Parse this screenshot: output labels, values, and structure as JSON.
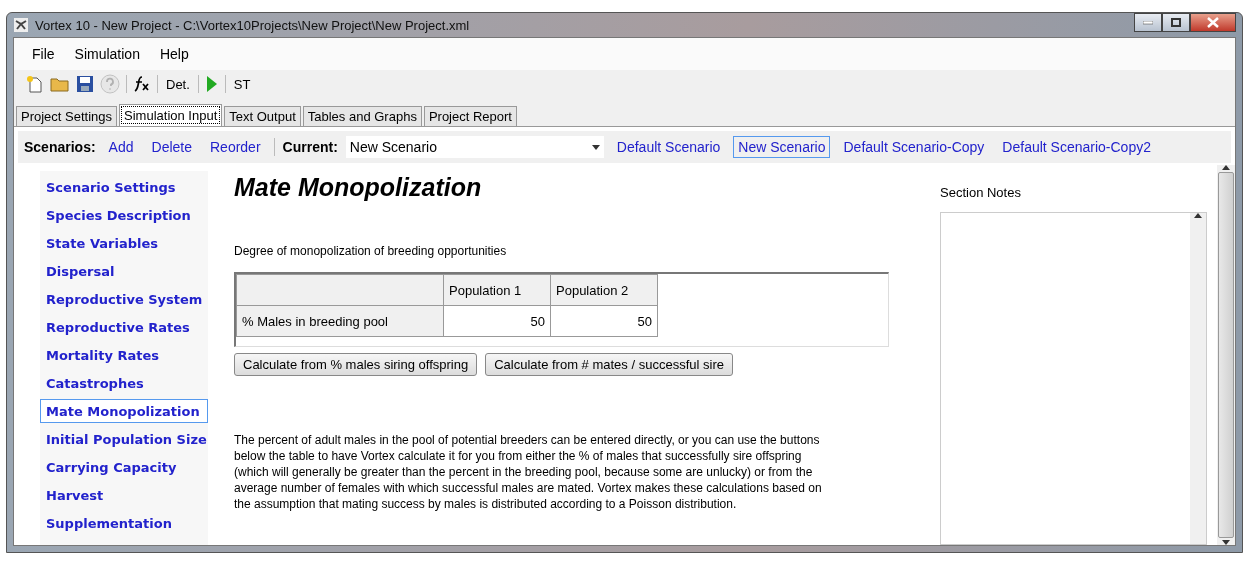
{
  "window": {
    "title": "Vortex 10 - New Project - C:\\Vortex10Projects\\New Project\\New Project.xml"
  },
  "menu": [
    "File",
    "Simulation",
    "Help"
  ],
  "toolbar": [
    {
      "kind": "new"
    },
    {
      "kind": "open"
    },
    {
      "kind": "save"
    },
    {
      "kind": "help",
      "disabled": true
    },
    {
      "kind": "sep"
    },
    {
      "kind": "fx"
    },
    {
      "kind": "sep"
    },
    {
      "kind": "text",
      "label": "Det."
    },
    {
      "kind": "sep"
    },
    {
      "kind": "run"
    },
    {
      "kind": "sep"
    },
    {
      "kind": "text",
      "label": "ST"
    }
  ],
  "tabs": [
    {
      "label": "Project Settings",
      "selected": false
    },
    {
      "label": "Simulation Input",
      "selected": true
    },
    {
      "label": "Text Output",
      "selected": false
    },
    {
      "label": "Tables and Graphs",
      "selected": false
    },
    {
      "label": "Project Report",
      "selected": false
    }
  ],
  "scenario_bar": {
    "label": "Scenarios:",
    "actions": [
      "Add",
      "Delete",
      "Reorder"
    ],
    "current_label": "Current:",
    "current_value": "New Scenario",
    "scenarios": [
      {
        "label": "Default Scenario",
        "selected": false
      },
      {
        "label": "New Scenario",
        "selected": true
      },
      {
        "label": "Default Scenario-Copy",
        "selected": false
      },
      {
        "label": "Default Scenario-Copy2",
        "selected": false
      }
    ]
  },
  "sidebar": {
    "items": [
      {
        "label": "Scenario Settings",
        "selected": false
      },
      {
        "label": "Species Description",
        "selected": false
      },
      {
        "label": "State Variables",
        "selected": false
      },
      {
        "label": "Dispersal",
        "selected": false
      },
      {
        "label": "Reproductive System",
        "selected": false
      },
      {
        "label": "Reproductive Rates",
        "selected": false
      },
      {
        "label": "Mortality Rates",
        "selected": false
      },
      {
        "label": "Catastrophes",
        "selected": false
      },
      {
        "label": "Mate Monopolization",
        "selected": true
      },
      {
        "label": "Initial Population Size",
        "selected": false
      },
      {
        "label": "Carrying Capacity",
        "selected": false
      },
      {
        "label": "Harvest",
        "selected": false
      },
      {
        "label": "Supplementation",
        "selected": false
      }
    ]
  },
  "section": {
    "title": "Mate Monopolization",
    "subtitle": "Degree of monopolization of breeding opportunities",
    "table": {
      "columns": [
        "Population 1",
        "Population 2"
      ],
      "rows": [
        {
          "label": "% Males in breeding pool",
          "values": [
            "50",
            "50"
          ]
        }
      ]
    },
    "buttons": [
      "Calculate from % males siring offspring",
      "Calculate from # mates / successful sire"
    ],
    "description_lines": [
      "The percent of adult males in the pool of potential breeders can be entered directly, or you can use the buttons",
      "below the table to have Vortex calculate it for you from either the % of males that successfully sire offspring",
      "(which will generally be greater than the percent in the breeding pool, because some are unlucky) or from the",
      "average number of females with which successful males are mated. Vortex makes these calculations based on",
      "the assumption that mating success by males is distributed according to a Poisson distribution."
    ]
  },
  "notes": {
    "label": "Section Notes"
  }
}
